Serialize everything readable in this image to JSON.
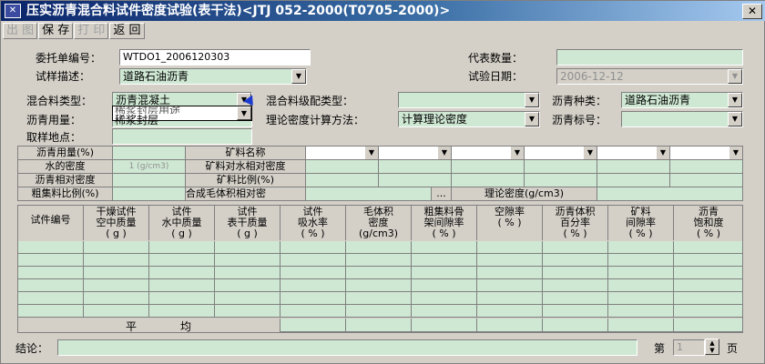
{
  "window": {
    "title": "压实沥青混合料试件密度试验(表干法)<JTJ 052-2000(T0705-2000)>",
    "close_label": "✕"
  },
  "toolbar": {
    "print_preview": "出 图",
    "save": "保 存",
    "print": "打 印",
    "back": "返 回"
  },
  "form": {
    "commission_no_label": "委托单编号：",
    "commission_no_value": "WTDO1_2006120303",
    "sample_desc_label": "试样描述：",
    "sample_desc_value": "道路石油沥青",
    "rep_qty_label": "代表数量：",
    "rep_qty_value": "",
    "test_date_label": "试验日期：",
    "test_date_value": "2006-12-12",
    "mix_type_label": "混合料类型：",
    "mix_type_value": "沥青混凝土",
    "mix_gradation_label": "混合料级配类型：",
    "mix_gradation_value": "",
    "asphalt_kind_label": "沥青种类：",
    "asphalt_kind_value": "道路石油沥青",
    "asphalt_amount_label": "沥青用量：",
    "asphalt_amount_value": "",
    "theory_density_method_label": "理论密度计算方法：",
    "theory_density_method_value": "计算理论密度",
    "asphalt_grade_label": "沥青标号：",
    "asphalt_grade_value": "",
    "sampling_site_label": "取样地点：",
    "sampling_site_value": ""
  },
  "dropdown": {
    "option_partial": "稀浆封层用途",
    "option_visible": "稀浆封层"
  },
  "param_grid": {
    "asphalt_amount_pct": "沥青用量(%)",
    "water_density": "水的密度",
    "water_density_value": "1 (g/cm3)",
    "asphalt_rel_density": "沥青相对密度",
    "coarse_ratio": "粗集料比例(%)",
    "mineral_name": "矿料名称",
    "mineral_rel_density": "矿料对水相对密度",
    "mineral_ratio": "矿料比例(%)",
    "synthetic_bulk": "合成毛体积相对密",
    "ellipsis": "...",
    "theory_density": "理论密度(g/cm3)"
  },
  "table": {
    "headers": [
      "试件编号",
      "干燥试件\n空中质量\n( g )",
      "试件\n水中质量\n( g )",
      "试件\n表干质量\n( g )",
      "试件\n吸水率\n( % )",
      "毛体积\n密度\n(g/cm3)",
      "粗集料骨\n架间隙率\n( % )",
      "空隙率\n( % )",
      "沥青体积\n百分率\n( % )",
      "矿料\n间隙率\n( % )",
      "沥青\n饱和度\n( % )"
    ],
    "average_label_1": "平",
    "average_label_2": "均"
  },
  "footer": {
    "conclusion_label": "结论：",
    "conclusion_value": "",
    "page_prefix": "第",
    "page_value": "1",
    "page_suffix": "页"
  }
}
